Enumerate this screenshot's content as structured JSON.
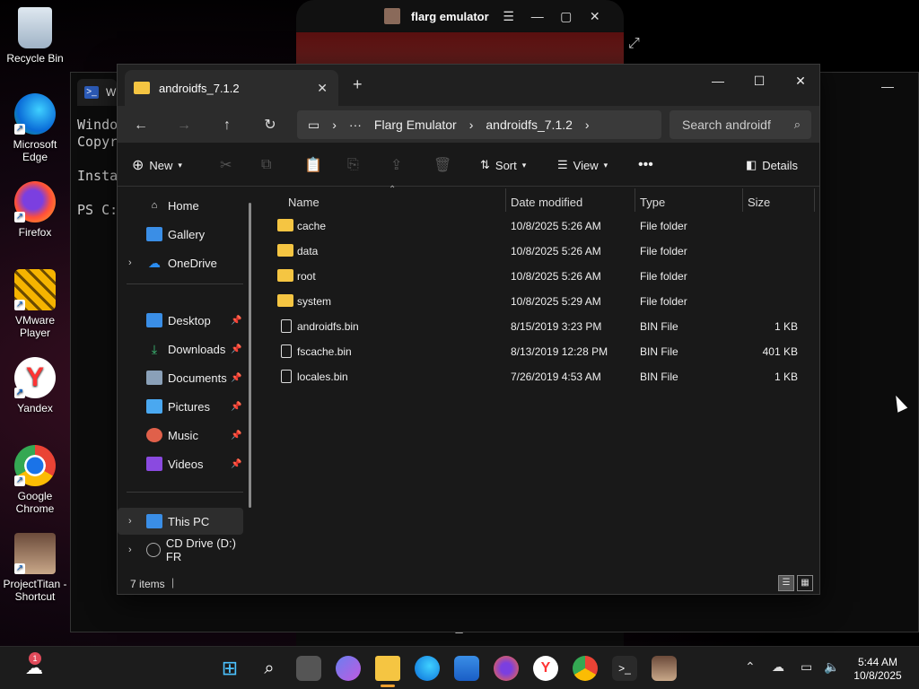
{
  "desktop": {
    "icons": [
      {
        "label": "Recycle Bin",
        "name": "recycle-bin-icon"
      },
      {
        "label": "Microsoft Edge",
        "name": "edge-icon"
      },
      {
        "label": "Firefox",
        "name": "firefox-icon"
      },
      {
        "label": "VMware Player",
        "name": "vmware-icon"
      },
      {
        "label": "Yandex",
        "name": "yandex-icon"
      },
      {
        "label": "Google Chrome",
        "name": "chrome-icon"
      },
      {
        "label": "ProjectTitan - Shortcut",
        "name": "projecttitan-icon"
      }
    ]
  },
  "emulator": {
    "title": "flarg emulator"
  },
  "powershell": {
    "tab_label": "W",
    "lines": [
      "Windo",
      "Copyr",
      "Insta",
      "PS C:"
    ]
  },
  "explorer": {
    "tab_title": "androidfs_7.1.2",
    "breadcrumb": [
      "Flarg Emulator",
      "androidfs_7.1.2"
    ],
    "search_placeholder": "Search androidf",
    "toolbar": {
      "new": "New",
      "sort": "Sort",
      "view": "View",
      "details": "Details"
    },
    "nav": [
      {
        "label": "Home",
        "icon": "home-icon"
      },
      {
        "label": "Gallery",
        "icon": "gallery-icon"
      },
      {
        "label": "OneDrive",
        "icon": "onedrive-icon"
      },
      {
        "label": "Desktop",
        "icon": "desktop-icon"
      },
      {
        "label": "Downloads",
        "icon": "downloads-icon"
      },
      {
        "label": "Documents",
        "icon": "documents-icon"
      },
      {
        "label": "Pictures",
        "icon": "pictures-icon"
      },
      {
        "label": "Music",
        "icon": "music-icon"
      },
      {
        "label": "Videos",
        "icon": "videos-icon"
      },
      {
        "label": "This PC",
        "icon": "this-pc-icon"
      },
      {
        "label": "CD Drive (D:) FR",
        "icon": "cd-drive-icon"
      }
    ],
    "columns": [
      "Name",
      "Date modified",
      "Type",
      "Size"
    ],
    "rows": [
      {
        "name": "cache",
        "date": "10/8/2025 5:26 AM",
        "type": "File folder",
        "size": "",
        "kind": "folder"
      },
      {
        "name": "data",
        "date": "10/8/2025 5:26 AM",
        "type": "File folder",
        "size": "",
        "kind": "folder"
      },
      {
        "name": "root",
        "date": "10/8/2025 5:26 AM",
        "type": "File folder",
        "size": "",
        "kind": "folder"
      },
      {
        "name": "system",
        "date": "10/8/2025 5:29 AM",
        "type": "File folder",
        "size": "",
        "kind": "folder"
      },
      {
        "name": "androidfs.bin",
        "date": "8/15/2019 3:23 PM",
        "type": "BIN File",
        "size": "1 KB",
        "kind": "file"
      },
      {
        "name": "fscache.bin",
        "date": "8/13/2019 12:28 PM",
        "type": "BIN File",
        "size": "401 KB",
        "kind": "file"
      },
      {
        "name": "locales.bin",
        "date": "7/26/2019 4:53 AM",
        "type": "BIN File",
        "size": "1 KB",
        "kind": "file"
      }
    ],
    "status": "7 items"
  },
  "taskbar": {
    "time": "5:44 AM",
    "date": "10/8/2025",
    "start_badge": "1"
  },
  "colors": {
    "accent": "#4cc2ff",
    "folder": "#f5c542"
  }
}
